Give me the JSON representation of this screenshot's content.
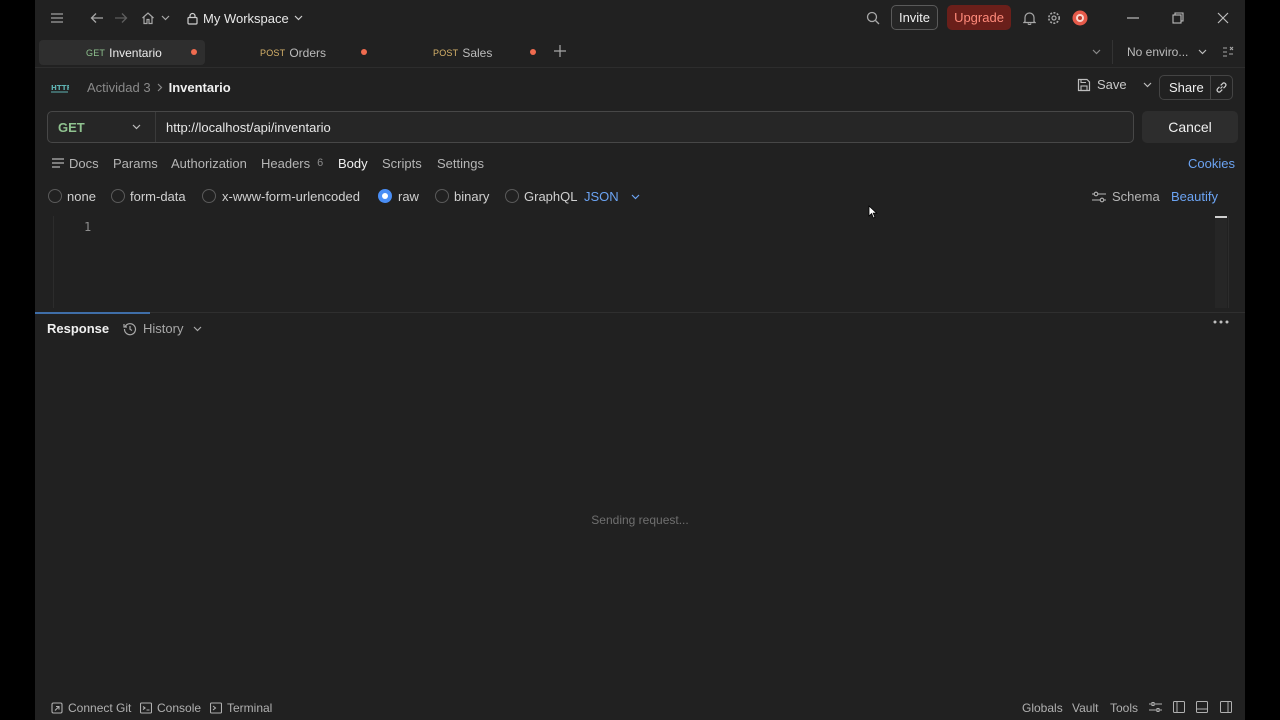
{
  "titlebar": {
    "workspace": "My Workspace",
    "invite_label": "Invite",
    "upgrade_label": "Upgrade",
    "icons": [
      "menu-icon",
      "back-arrow-icon",
      "forward-arrow-icon",
      "home-icon",
      "lock-icon",
      "search-icon",
      "bell-icon",
      "gear-icon",
      "avatar",
      "minimize-icon",
      "restore-icon",
      "close-icon"
    ]
  },
  "tabs": [
    {
      "method": "GET",
      "name": "Inventario",
      "active": true,
      "unsaved": true
    },
    {
      "method": "POST",
      "name": "Orders",
      "active": false,
      "unsaved": true
    },
    {
      "method": "POST",
      "name": "Sales",
      "active": false,
      "unsaved": true
    }
  ],
  "environment": "No enviro...",
  "breadcrumb": {
    "parent": "Actividad 3",
    "current": "Inventario",
    "badge": "HTTP"
  },
  "actions": {
    "save_label": "Save",
    "share_label": "Share"
  },
  "request": {
    "method": "GET",
    "url": "http://localhost/api/inventario",
    "cancel_label": "Cancel"
  },
  "request_tabs": {
    "docs": "Docs",
    "params": "Params",
    "authorization": "Authorization",
    "headers": "Headers",
    "headers_count": "6",
    "body": "Body",
    "scripts": "Scripts",
    "settings": "Settings",
    "cookies": "Cookies",
    "active": "Body"
  },
  "body_options": {
    "none": "none",
    "form_data": "form-data",
    "urlencoded": "x-www-form-urlencoded",
    "raw": "raw",
    "binary": "binary",
    "graphql": "GraphQL",
    "format": "JSON",
    "selected": "raw",
    "schema": "Schema",
    "beautify": "Beautify"
  },
  "editor": {
    "line_number": "1"
  },
  "response": {
    "label": "Response",
    "history": "History",
    "status": "Sending request..."
  },
  "statusbar": {
    "connect_git": "Connect Git",
    "console": "Console",
    "terminal": "Terminal",
    "globals": "Globals",
    "vault": "Vault",
    "tools": "Tools"
  },
  "colors": {
    "background": "#212121",
    "accent_blue": "#6ba3f2",
    "get_green": "#8fc28f",
    "post_orange": "#d8b36a",
    "upgrade_bg": "#6a1f1a",
    "unsaved_dot": "#f06b4f"
  }
}
